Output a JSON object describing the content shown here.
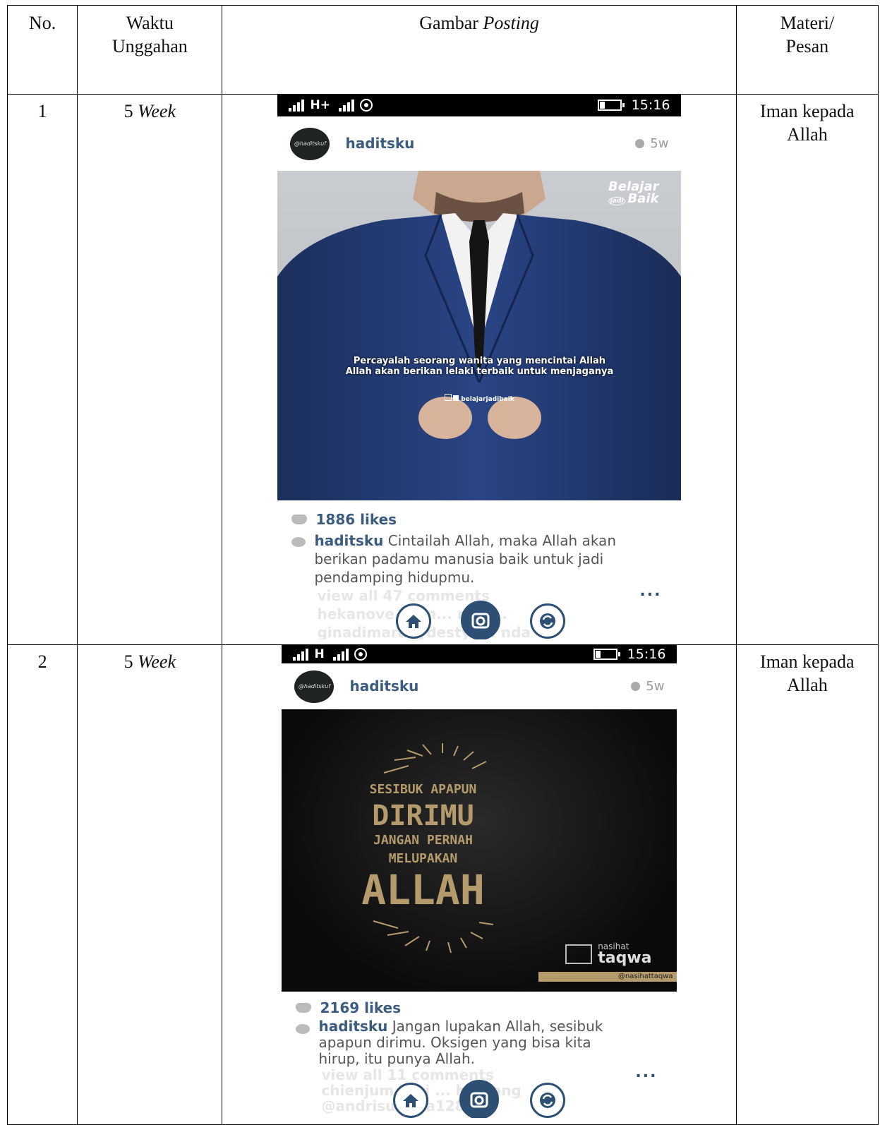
{
  "headers": {
    "no": "No.",
    "waktu": "Waktu Unggahan",
    "gambar_plain": "Gambar ",
    "gambar_italic": "Posting",
    "materi": "Materi/ Pesan"
  },
  "rows": [
    {
      "no": "1",
      "time_num": "5 ",
      "time_unit": "Week",
      "materi": "Iman kepada Allah",
      "post": {
        "status_net": "H+",
        "status_time": "15:16",
        "avatar": "@haditskuf",
        "username": "haditsku",
        "age": "5w",
        "brand_top": "Belajar",
        "brand_mid": "jadi",
        "brand_bottom": "Baik",
        "quote_line1": "Percayalah seorang wanita yang mencintai Allah",
        "quote_line2": "Allah akan berikan lelaki terbaik untuk menjaganya",
        "social_handle": "belajarjadibaik",
        "likes": "1886 likes",
        "caption_user": "haditsku",
        "caption_text": "Cintailah Allah, maka Allah akan berikan padamu manusia baik untuk jadi pendamping hidupmu.",
        "view_all": "view all 47 comments",
        "comment_a": "hekanove... An... nela...",
        "comment_b": "ginadimara @destya... nda",
        "more": "..."
      }
    },
    {
      "no": "2",
      "time_num": "5 ",
      "time_unit": "Week",
      "materi": "Iman kepada Allah",
      "post": {
        "status_net": "H",
        "status_time": "15:16",
        "avatar": "@haditskuf",
        "username": "haditsku",
        "age": "5w",
        "poster_line1": "SESIBUK APAPUN",
        "poster_line2": "DIRIMU",
        "poster_line3": "JANGAN PERNAH",
        "poster_line4": "MELUPAKAN",
        "poster_line5": "ALLAH",
        "brand_small": "nasihat",
        "brand_big": "taqwa",
        "brand_handle": "@nasihattaqwa",
        "likes": "2169 likes",
        "caption_user": "haditsku",
        "caption_text": "Jangan lupakan Allah, sesibuk apapun dirimu. Oksigen yang bisa kita hirup, itu punya Allah.",
        "view_all": "view all 11 comments",
        "comment_a": "chienjum... ni ... h ... ang",
        "comment_b": "@andrisuk... a128",
        "more": "..."
      }
    }
  ],
  "colors": {
    "link_blue": "#3b5c7f",
    "nav_blue": "#2d4f73",
    "poster_gold": "#b59a6b",
    "suit_blue": "#233a6e"
  }
}
